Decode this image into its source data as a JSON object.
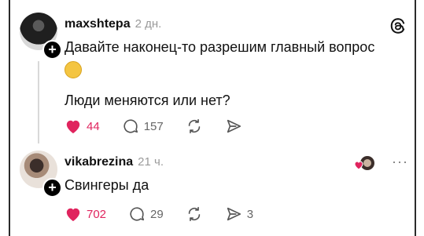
{
  "posts": [
    {
      "username": "maxshtepa",
      "time": "2 дн.",
      "text_line1": "Давайте наконец-то разрешим главный вопрос",
      "text_line2": "Люди меняются или нет?",
      "likes": "44",
      "comments": "157",
      "shares": ""
    },
    {
      "username": "vikabrezina",
      "time": "21 ч.",
      "text_line1": "Свингеры да",
      "likes": "702",
      "comments": "29",
      "shares": "3"
    }
  ],
  "colors": {
    "like": "#e0245e",
    "muted": "#9a9a9a"
  },
  "icons": [
    "heart-icon",
    "comment-icon",
    "repost-icon",
    "share-icon",
    "threads-logo-icon",
    "more-icon",
    "plus-icon",
    "thinking-emoji-icon"
  ]
}
